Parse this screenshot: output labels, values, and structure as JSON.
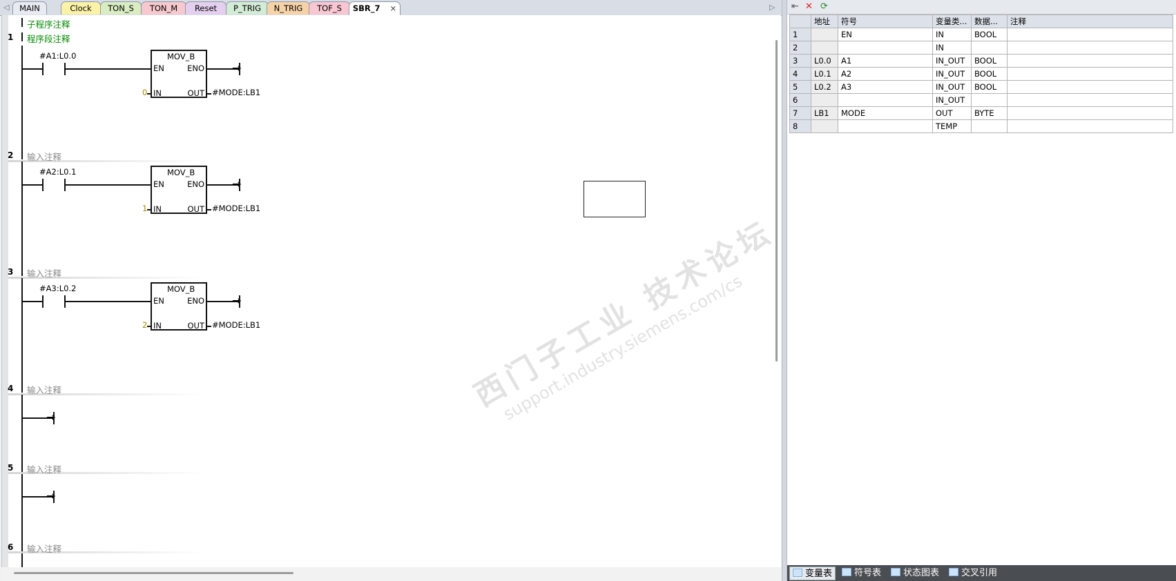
{
  "tabs": {
    "items": [
      {
        "label": "MAIN",
        "color": "#e8ecf2"
      },
      {
        "label": "Clock",
        "color": "#fbf2a8"
      },
      {
        "label": "TON_S",
        "color": "#d9ecc2"
      },
      {
        "label": "TON_M",
        "color": "#f7c9cf"
      },
      {
        "label": "Reset",
        "color": "#e4cfee"
      },
      {
        "label": "P_TRIG",
        "color": "#d3ecd6"
      },
      {
        "label": "N_TRIG",
        "color": "#f6d3a7"
      },
      {
        "label": "TOF_S",
        "color": "#f8c7d1"
      },
      {
        "label": "SBR_7",
        "color": "#ffffff"
      }
    ],
    "close_glyph": "×",
    "left_arrow": "◁",
    "right_arrow": "▷"
  },
  "editor": {
    "subroutine_comment": "子程序注释",
    "networks": [
      {
        "number": "1",
        "comment": "程序段注释",
        "contact": "#A1:L0.0",
        "block": "MOV_B",
        "en": "EN",
        "eno": "ENO",
        "in_label": "IN",
        "out_label": "OUT",
        "in_value": "0",
        "out_value": "#MODE:LB1"
      },
      {
        "number": "2",
        "comment": "输入注释",
        "contact": "#A2:L0.1",
        "block": "MOV_B",
        "en": "EN",
        "eno": "ENO",
        "in_label": "IN",
        "out_label": "OUT",
        "in_value": "1",
        "out_value": "#MODE:LB1"
      },
      {
        "number": "3",
        "comment": "输入注释",
        "contact": "#A3:L0.2",
        "block": "MOV_B",
        "en": "EN",
        "eno": "ENO",
        "in_label": "IN",
        "out_label": "OUT",
        "in_value": "2",
        "out_value": "#MODE:LB1"
      },
      {
        "number": "4",
        "comment": "输入注释"
      },
      {
        "number": "5",
        "comment": "输入注释"
      },
      {
        "number": "6",
        "comment": "输入注释"
      }
    ],
    "watermark_line1": "西门子工业 技术论坛",
    "watermark_line2": "support.industry.siemens.com/cs"
  },
  "vartable": {
    "toolbar_icons": [
      "insert-row-icon",
      "delete-row-icon",
      "update-icon"
    ],
    "headers": [
      "",
      "地址",
      "符号",
      "变量类...",
      "数据...",
      "注释"
    ],
    "rows": [
      {
        "n": "1",
        "addr": "",
        "symbol": "EN",
        "vartype": "IN",
        "datatype": "BOOL",
        "comment": ""
      },
      {
        "n": "2",
        "addr": "",
        "symbol": "",
        "vartype": "IN",
        "datatype": "",
        "comment": ""
      },
      {
        "n": "3",
        "addr": "L0.0",
        "symbol": "A1",
        "vartype": "IN_OUT",
        "datatype": "BOOL",
        "comment": ""
      },
      {
        "n": "4",
        "addr": "L0.1",
        "symbol": "A2",
        "vartype": "IN_OUT",
        "datatype": "BOOL",
        "comment": ""
      },
      {
        "n": "5",
        "addr": "L0.2",
        "symbol": "A3",
        "vartype": "IN_OUT",
        "datatype": "BOOL",
        "comment": ""
      },
      {
        "n": "6",
        "addr": "",
        "symbol": "",
        "vartype": "IN_OUT",
        "datatype": "",
        "comment": ""
      },
      {
        "n": "7",
        "addr": "LB1",
        "symbol": "MODE",
        "vartype": "OUT",
        "datatype": "BYTE",
        "comment": ""
      },
      {
        "n": "8",
        "addr": "",
        "symbol": "",
        "vartype": "TEMP",
        "datatype": "",
        "comment": ""
      }
    ],
    "bottom_tabs": [
      "变量表",
      "符号表",
      "状态图表",
      "交叉引用"
    ]
  }
}
